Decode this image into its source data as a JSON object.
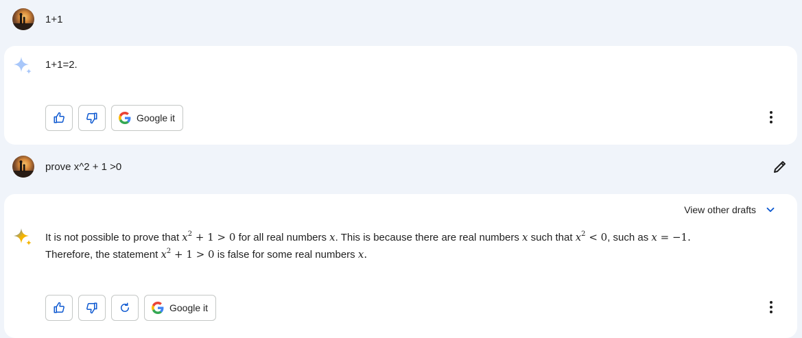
{
  "conversation": [
    {
      "user": {
        "prompt": "1+1"
      },
      "response": {
        "text": "1+1=2.",
        "actions": {
          "google_it_label": "Google it"
        }
      }
    },
    {
      "user": {
        "prompt": "prove x^2 + 1 >0"
      },
      "response": {
        "view_drafts_label": "View other drafts",
        "line1_a": "It is not possible to prove that",
        "line1_b": "for all real numbers",
        "line1_c": ". This is because there are real numbers",
        "line1_d": "such that",
        "line1_e": ", such as",
        "line2_a": "Therefore, the statement",
        "line2_b": "is false for some real numbers",
        "actions": {
          "google_it_label": "Google it"
        }
      }
    }
  ],
  "colors": {
    "page_bg": "#f0f4fa",
    "card_bg": "#ffffff",
    "icon_blue": "#0b57d0"
  },
  "icons": [
    "avatar",
    "sparkle-icon",
    "thumbs-up-icon",
    "thumbs-down-icon",
    "google-g-icon",
    "more-vert-icon",
    "edit-icon",
    "chevron-down-icon",
    "regenerate-icon"
  ]
}
